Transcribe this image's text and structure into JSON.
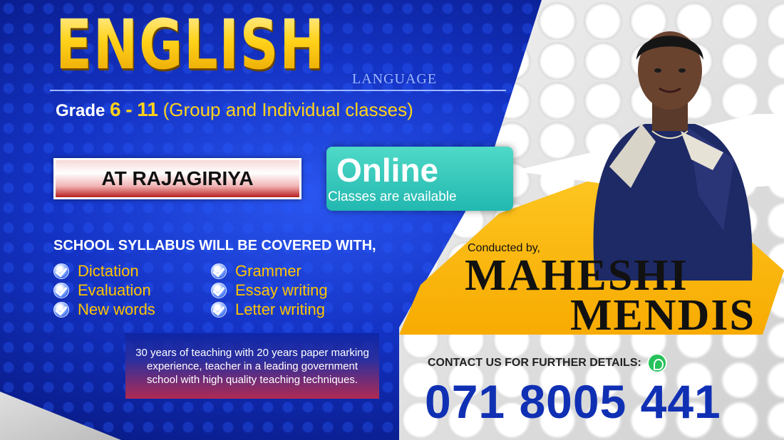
{
  "header": {
    "title": "ENGLISH",
    "subtitle": "LANGUAGE",
    "grade_label": "Grade",
    "grade_from": "6",
    "grade_sep": "-",
    "grade_to": "11",
    "grade_desc": "(Group and Individual classes)"
  },
  "location": "AT RAJAGIRIYA",
  "online": {
    "title": "Online",
    "subtitle": "Classes are available"
  },
  "syllabus": {
    "title": "SCHOOL SYLLABUS WILL BE COVERED WITH,",
    "topics": [
      "Dictation",
      "Evaluation",
      "New words",
      "Grammer",
      "Essay writing",
      "Letter writing"
    ]
  },
  "experience": "30 years of teaching with 20 years paper marking experience, teacher in a leading government school with high quality teaching techniques.",
  "teacher": {
    "conducted_label": "Conducted by,",
    "first_name": "MAHESHI",
    "last_name": "MENDIS"
  },
  "contact": {
    "label": "CONTACT US FOR FURTHER DETAILS:",
    "phone": "071 8005 441"
  },
  "colors": {
    "background_blue": "#1433c4",
    "accent_gold": "#ffc400",
    "band_yellow": "#f7aa00",
    "phone_blue": "#1030b4",
    "whatsapp_green": "#25c25a"
  },
  "icons": [
    "check-icon",
    "whatsapp-icon"
  ]
}
